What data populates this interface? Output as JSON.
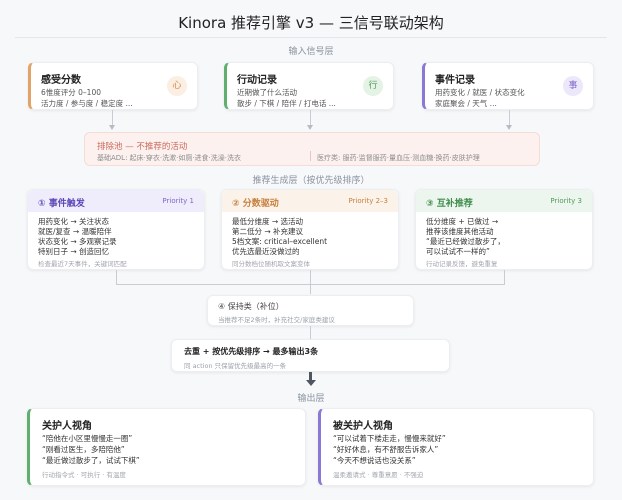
{
  "title": "Kinora 推荐引擎 v3 — 三信号联动架构",
  "sections": {
    "input": "输入信号层",
    "generate": "推荐生成层（按优先级排序）",
    "output": "输出层"
  },
  "signals": [
    {
      "title": "感受分数",
      "line1": "6惟度评分 0–100",
      "line2": "活力度 / 参与度 / 稳定度 ...",
      "badge": "心"
    },
    {
      "title": "行动记录",
      "line1": "近期做了什么活动",
      "line2": "散步 / 下棋 / 陪伴 / 打电话 ...",
      "badge": "行"
    },
    {
      "title": "事件记录",
      "line1": "用药变化 / 就医 / 状态变化",
      "line2": "家庭聚会 / 天气 ...",
      "badge": "事"
    }
  ],
  "exclusion": {
    "title": "排除池 — 不推荐的活动",
    "left": "基础ADL: 起床·穿衣·洗漱·如厕·进食·洗澡·洗衣",
    "right": "医疗类: 服药·监督服药·量血压·测血糖·换药·皮肤护理"
  },
  "generators": [
    {
      "title": "① 事件触发",
      "priority": "Priority 1",
      "lines": [
        "用药变化 → 关注状态",
        "就医/复查 → 温暖陪伴",
        "状态变化 → 多观察记录",
        "特别日子 → 创造回忆"
      ],
      "footer": "检查最近7天事件，关键词匹配"
    },
    {
      "title": "② 分数驱动",
      "priority": "Priority 2–3",
      "lines": [
        "最低分维度 → 选活动",
        "第二低分 → 补充建议",
        "5档文案: critical–excellent",
        "优先选最近没做过的"
      ],
      "footer": "同分数档位随机取文案变体"
    },
    {
      "title": "③ 互补推荐",
      "priority": "Priority 3",
      "lines": [
        "低分维度 + 已做过 →",
        "推荐该维度其他活动",
        "“最近已经做过散步了，",
        "可以试试不一样的”"
      ],
      "footer": "行动记录反馈，避免重复"
    }
  ],
  "fallback": {
    "title": "④ 保持类（补位）",
    "sub": "当推荐不足2条时，补充社交/家庭类建议"
  },
  "dedupe": {
    "title": "去重 + 按优先级排序 → 最多输出3条",
    "sub": "同 action 只保留优先级最高的一条"
  },
  "outputs": [
    {
      "title": "关护人视角",
      "lines": [
        "“陪他在小区里慢慢走一圈”",
        "“刚看过医生，多陪陪他”",
        "“最近做过散步了，试试下棋”"
      ],
      "footer": "行动指令式 · 可执行 · 有温度"
    },
    {
      "title": "被关护人视角",
      "lines": [
        "“可以试着下楼走走，慢慢来就好”",
        "“好好休息，有不舒服告诉家人”",
        "“今天不想说话也没关系”"
      ],
      "footer": "温柔邀请式 · 尊重意愿 · 不强迫"
    }
  ],
  "colors": {
    "orange": "#e2a36a",
    "green": "#5fb06e",
    "purple": "#8c76d6",
    "warn": "#c96b5c"
  }
}
